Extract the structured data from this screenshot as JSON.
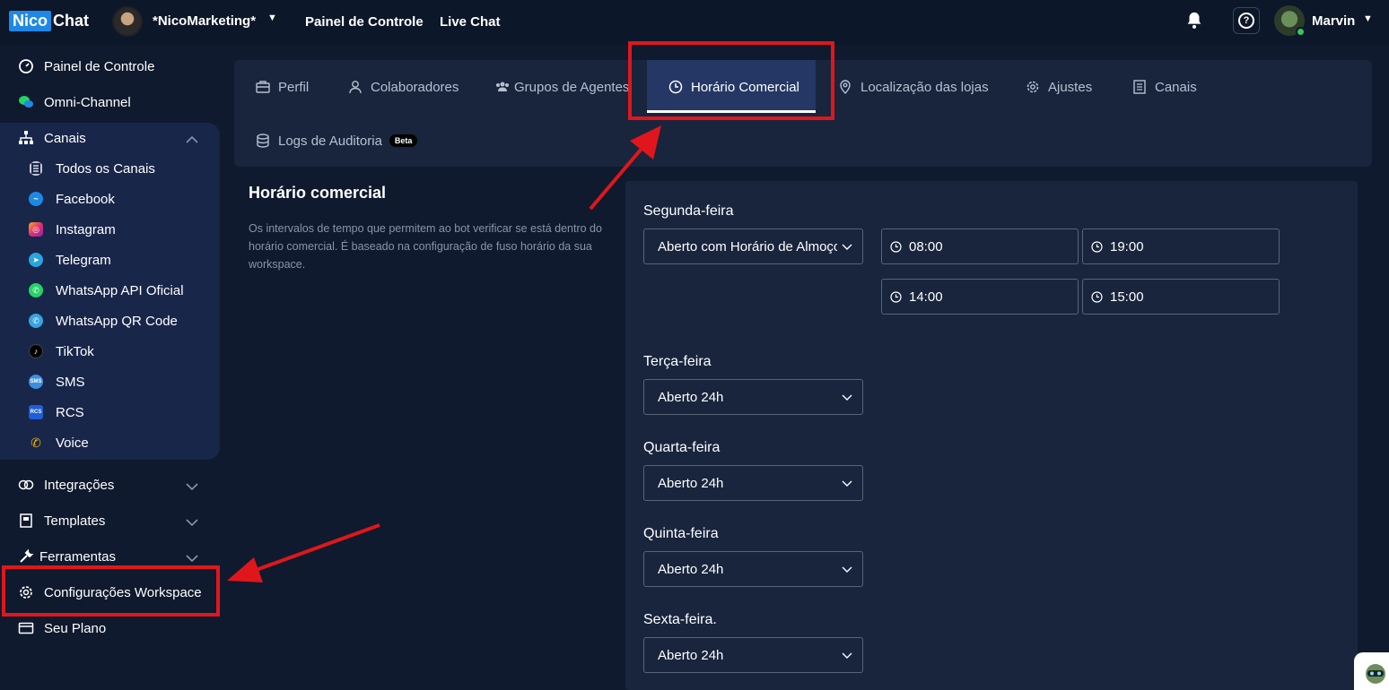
{
  "header": {
    "logo_part1": "Nico",
    "logo_part2": "Chat",
    "workspace_name": "*NicoMarketing*",
    "nav": [
      "Painel de Controle",
      "Live Chat"
    ],
    "help_symbol": "?",
    "user_name": "Marvin"
  },
  "sidebar": {
    "items_top": [
      {
        "label": "Painel de Controle",
        "icon": "dashboard-icon"
      },
      {
        "label": "Omni-Channel",
        "icon": "chat-icon"
      },
      {
        "label": "Canais",
        "icon": "sitemap-icon"
      }
    ],
    "canais_sub": [
      {
        "label": "Todos os Canais",
        "icon": "list-icon",
        "color": "#ffffff"
      },
      {
        "label": "Facebook",
        "icon": "messenger-icon",
        "color": "#1e88e5"
      },
      {
        "label": "Instagram",
        "icon": "instagram-icon",
        "color": "#e1306c"
      },
      {
        "label": "Telegram",
        "icon": "telegram-icon",
        "color": "#2aa3df"
      },
      {
        "label": "WhatsApp API Oficial",
        "icon": "whatsapp-icon",
        "color": "#25d366"
      },
      {
        "label": "WhatsApp QR Code",
        "icon": "whatsapp-qr-icon",
        "color": "#38a3e0"
      },
      {
        "label": "TikTok",
        "icon": "tiktok-icon",
        "color": "#000000"
      },
      {
        "label": "SMS",
        "icon": "sms-icon",
        "color": "#3b8fe0"
      },
      {
        "label": "RCS",
        "icon": "rcs-icon",
        "color": "#1e5ed6"
      },
      {
        "label": "Voice",
        "icon": "phone-icon",
        "color": "#f5b400"
      }
    ],
    "items_bottom": [
      {
        "label": "Integrações",
        "icon": "integrations-icon"
      },
      {
        "label": "Templates",
        "icon": "template-icon"
      },
      {
        "label": "Ferramentas",
        "icon": "wrench-icon"
      },
      {
        "label": "Configurações Workspace",
        "icon": "gear-icon"
      },
      {
        "label": "Seu Plano",
        "icon": "card-icon"
      }
    ],
    "sub_abbrev": {
      "sms": "SMS",
      "rcs": "RCS"
    }
  },
  "tabs": [
    {
      "label": "Perfil",
      "icon": "briefcase-icon"
    },
    {
      "label": "Colaboradores",
      "icon": "user-icon"
    },
    {
      "label": "Grupos de Agentes",
      "icon": "users-icon"
    },
    {
      "label": "Horário Comercial",
      "icon": "clock-icon",
      "active": true
    },
    {
      "label": "Localização das lojas",
      "icon": "location-icon"
    },
    {
      "label": "Ajustes",
      "icon": "gear-icon"
    },
    {
      "label": "Canais",
      "icon": "list-icon"
    },
    {
      "label": "Logs de Auditoria",
      "icon": "database-icon",
      "badge": "Beta"
    }
  ],
  "section": {
    "title": "Horário comercial",
    "description": "Os intervalos de tempo que permitem ao bot verificar se está dentro do horário comercial. É baseado na configuração de fuso horário da sua workspace."
  },
  "days": [
    {
      "name": "Segunda-feira",
      "mode": "Aberto com Horário de Almoço",
      "times": [
        "08:00",
        "19:00",
        "14:00",
        "15:00"
      ]
    },
    {
      "name": "Terça-feira",
      "mode": "Aberto 24h"
    },
    {
      "name": "Quarta-feira",
      "mode": "Aberto 24h"
    },
    {
      "name": "Quinta-feira",
      "mode": "Aberto 24h"
    },
    {
      "name": "Sexta-feira.",
      "mode": "Aberto 24h"
    }
  ],
  "colors": {
    "accent": "#1e88e5",
    "highlight": "#e0161c",
    "background": "#0f1a2e",
    "panel": "#18253d",
    "active_tab": "#243765"
  }
}
